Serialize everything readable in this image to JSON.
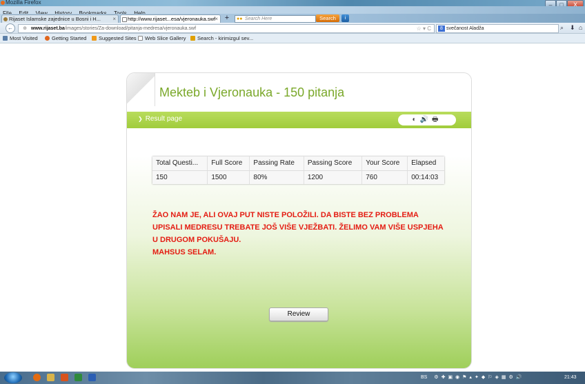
{
  "window": {
    "title": "Mozilla Firefox",
    "controls": {
      "minimize": "–",
      "maximize": "□",
      "close": "X"
    }
  },
  "menu": [
    "File",
    "Edit",
    "View",
    "History",
    "Bookmarks",
    "Tools",
    "Help"
  ],
  "tabs": [
    {
      "label": "Rijaset Islamske zajednice u Bosni i H...",
      "close": "×"
    },
    {
      "label": "http://www.rijaset...esa/vjeronauka.swf",
      "close": "×"
    }
  ],
  "new_tab": "+",
  "search": {
    "placeholder": "Search Here",
    "button": "Search",
    "info": "i"
  },
  "nav": {
    "back": "←",
    "url_host": "www.rijaset.ba",
    "url_path": "/images/stories/Za-download/pitanja-medresa/vjeronauka.swf",
    "url_icons": "☆ ▾ C",
    "search_engine": "8",
    "search_value": "svečanost Aladža",
    "search_icon": "⌕",
    "download_icon": "⬇",
    "home_icon": "⌂"
  },
  "bookmarks": [
    "Most Visited",
    "Getting Started",
    "Suggested Sites",
    "Web Slice Gallery",
    "Search - kirimizgul sev..."
  ],
  "app": {
    "title": "Mekteb i Vjeronauka - 150 pitanja",
    "section": "Result page",
    "section_arrow": "❯",
    "tools": "◐🔊🖶"
  },
  "results": {
    "headers": [
      "Total Questi...",
      "Full Score",
      "Passing Rate",
      "Passing Score",
      "Your Score",
      "Elapsed"
    ],
    "values": [
      "150",
      "1500",
      "80%",
      "1200",
      "760",
      "00:14:03"
    ]
  },
  "message": [
    "ŽAO NAM JE, ALI OVAJ PUT NISTE POLOŽILI. DA BISTE BEZ PROBLEMA",
    "UPISALI MEDRESU TREBATE JOŠ VIŠE VJEŽBATI.  ŽELIMO VAM VIŠE USPJEHA",
    "U DRUGOM POKUŠAJU.",
    "MAHSUS SELAM."
  ],
  "review_button": "Review",
  "taskbar": {
    "language": "BS",
    "clock": "21:43"
  },
  "colors": {
    "accent_green": "#a1cc3c",
    "title_green": "#7aa82a",
    "message_red": "#e41c12"
  }
}
